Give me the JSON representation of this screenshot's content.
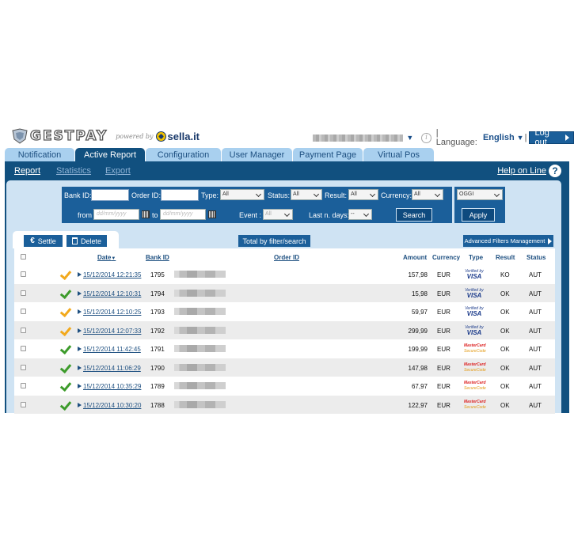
{
  "header": {
    "logo_text": "GESTPAY",
    "powered_by": "powered by",
    "sella": "sella.it",
    "user_dropdown": "▼",
    "info_icon": "i",
    "language_label": "| Language:",
    "language_value": "English",
    "language_dropdown": "▼",
    "language_sep": "|",
    "logout": "Log out"
  },
  "tabs": [
    {
      "label": "Notification"
    },
    {
      "label": "Active Report"
    },
    {
      "label": "Configuration"
    },
    {
      "label": "User Manager"
    },
    {
      "label": "Payment Page"
    },
    {
      "label": "Virtual Pos"
    }
  ],
  "subnav": {
    "report": "Report",
    "statistics": "Statistics",
    "export": "Export",
    "help": "Help on Line",
    "help_icon": "?"
  },
  "filters": {
    "bank_id_label": "Bank ID:",
    "order_id_label": "Order ID:",
    "type_label": "Type:",
    "type_value": "All",
    "status_label": "Status:",
    "status_value": "All",
    "result_label": "Result:",
    "result_value": "All",
    "currency_label": "Currency:",
    "currency_value": "All",
    "from_label": "from",
    "from_placeholder": "dd/mm/yyyy",
    "to_label": "to",
    "to_placeholder": "dd/mm/yyyy",
    "event_label": "Event :",
    "event_value": "All",
    "lastn_label": "Last n. days:",
    "lastn_value": "--",
    "search_button": "Search",
    "period_value": "OGGI",
    "apply_button": "Apply"
  },
  "actions": {
    "settle": "Settle",
    "euro_symbol": "€",
    "delete": "Delete",
    "total": "Total by filter/search",
    "advanced": "Advanced Filters Management"
  },
  "table": {
    "headers": {
      "date": "Date",
      "sort_marker": "▼",
      "bank_id": "Bank ID",
      "order_id": "Order ID",
      "amount": "Amount",
      "currency": "Currency",
      "type": "Type",
      "result": "Result",
      "status": "Status"
    },
    "rows": [
      {
        "check": "orange",
        "date": "15/12/2014 12:21:35",
        "bank_id": "1795",
        "amount": "157,98",
        "currency": "EUR",
        "card": "visa",
        "result": "KO",
        "status": "AUT"
      },
      {
        "check": "green",
        "date": "15/12/2014 12:10:31",
        "bank_id": "1794",
        "amount": "15,98",
        "currency": "EUR",
        "card": "visa",
        "result": "OK",
        "status": "AUT"
      },
      {
        "check": "orange",
        "date": "15/12/2014 12:10:25",
        "bank_id": "1793",
        "amount": "59,97",
        "currency": "EUR",
        "card": "visa",
        "result": "OK",
        "status": "AUT"
      },
      {
        "check": "orange",
        "date": "15/12/2014 12:07:33",
        "bank_id": "1792",
        "amount": "299,99",
        "currency": "EUR",
        "card": "visa",
        "result": "OK",
        "status": "AUT"
      },
      {
        "check": "green",
        "date": "15/12/2014 11:42:45",
        "bank_id": "1791",
        "amount": "199,99",
        "currency": "EUR",
        "card": "mastercard",
        "result": "OK",
        "status": "AUT"
      },
      {
        "check": "green",
        "date": "15/12/2014 11:06:29",
        "bank_id": "1790",
        "amount": "147,98",
        "currency": "EUR",
        "card": "mastercard",
        "result": "OK",
        "status": "AUT"
      },
      {
        "check": "green",
        "date": "15/12/2014 10:35:29",
        "bank_id": "1789",
        "amount": "67,97",
        "currency": "EUR",
        "card": "mastercard",
        "result": "OK",
        "status": "AUT"
      },
      {
        "check": "green",
        "date": "15/12/2014 10:30:20",
        "bank_id": "1788",
        "amount": "122,97",
        "currency": "EUR",
        "card": "mastercard",
        "result": "OK",
        "status": "AUT"
      }
    ]
  },
  "card_labels": {
    "visa_top": "Verified by",
    "visa_bottom": "VISA",
    "mc_top": "MasterCard",
    "mc_bottom": "SecureCode"
  },
  "colors": {
    "brand_blue": "#11507f",
    "tab_inactive": "#a9d0ef",
    "panel_bg": "#cfe3f3",
    "ok_green": "#3d9b2b",
    "pending_orange": "#f2a91c"
  },
  "icons": {
    "check_green": "check-green-icon",
    "check_orange": "check-orange-icon",
    "expand": "triangle-right-icon",
    "calendar": "calendar-icon",
    "trash": "trash-icon",
    "help": "help-icon",
    "info": "info-icon"
  }
}
